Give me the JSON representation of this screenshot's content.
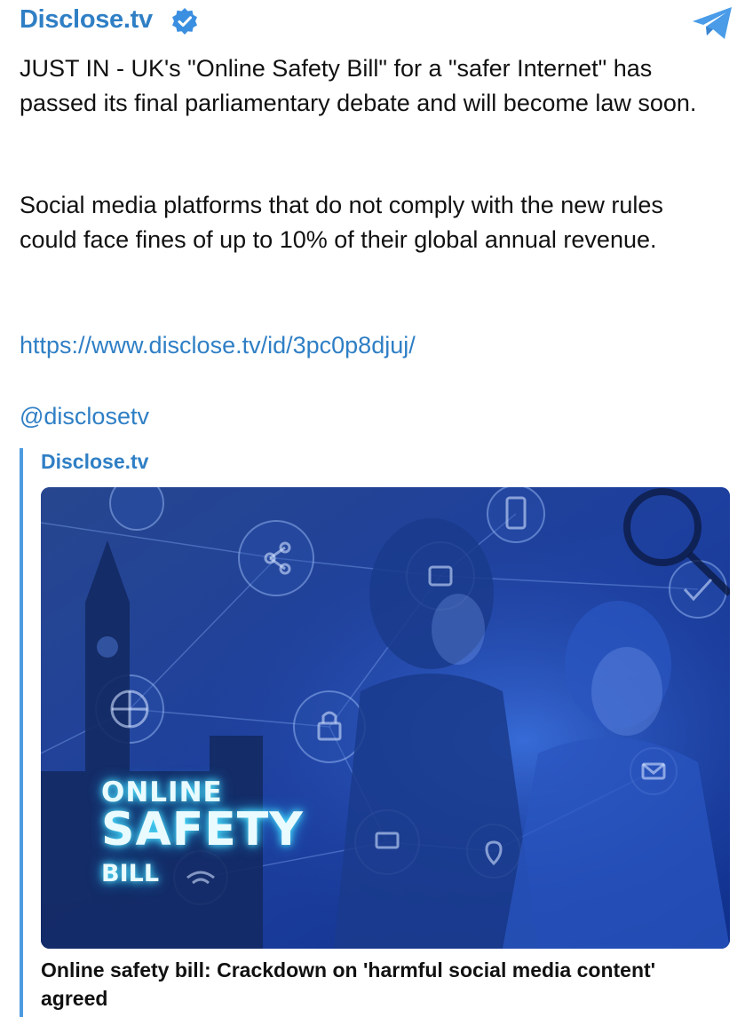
{
  "header": {
    "channel_name": "Disclose.tv",
    "verified_icon": "verified-badge-icon",
    "share_icon": "telegram-icon",
    "accent_color": "#2f7fc5"
  },
  "post": {
    "paragraph_1": "JUST IN - UK's \"Online Safety Bill\" for a \"safer Internet\" has passed its final parliamentary debate and will become law soon.",
    "paragraph_2": "Social media platforms that do not comply with the new rules could face fines of up to 10% of their global annual revenue.",
    "link": "https://www.disclose.tv/id/3pc0p8djuj/",
    "handle": "@disclosetv"
  },
  "link_preview": {
    "site_name": "Disclose.tv",
    "image_text": {
      "line1": "ONLINE",
      "line2": "SAFETY",
      "line3": "BILL"
    },
    "title": "Online safety bill: Crackdown on 'harmful social media content' agreed"
  }
}
